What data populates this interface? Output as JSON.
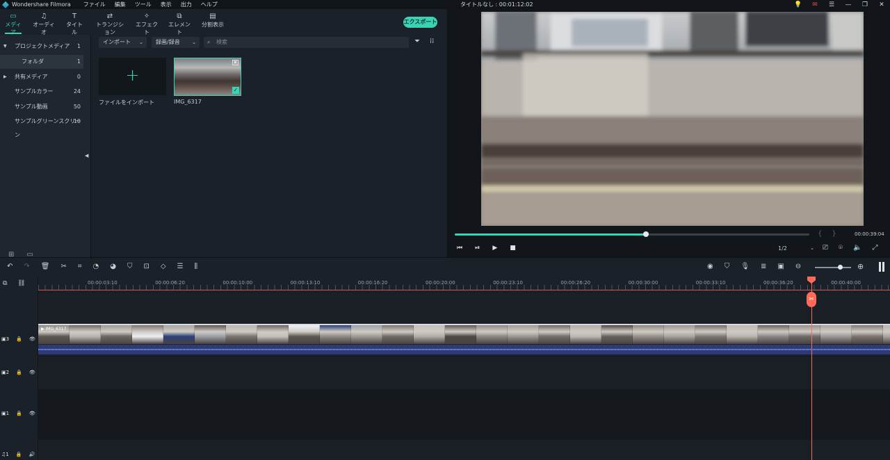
{
  "titlebar": {
    "app_name": "Wondershare Filmora",
    "menu": [
      "ファイル",
      "編集",
      "ツール",
      "表示",
      "出力",
      "ヘルプ"
    ],
    "window_title": "タイトルなし : 00:01:12:02",
    "buttons": [
      "bulb-icon",
      "mail-icon",
      "menu-icon",
      "minimize-icon",
      "maximize-icon",
      "close-icon"
    ]
  },
  "tabs": [
    {
      "label": "メディア",
      "icon": "folder-icon",
      "active": true
    },
    {
      "label": "オーディオ",
      "icon": "music-icon"
    },
    {
      "label": "タイトル",
      "icon": "title-icon"
    },
    {
      "label": "トランジション",
      "icon": "transition-icon"
    },
    {
      "label": "エフェクト",
      "icon": "effect-icon"
    },
    {
      "label": "エレメント",
      "icon": "element-icon"
    },
    {
      "label": "分割表示",
      "icon": "split-screen-icon"
    }
  ],
  "export_label": "エクスポート",
  "sidebar": {
    "items": [
      {
        "label": "プロジェクトメディア",
        "count": "1",
        "expandable": true
      },
      {
        "label": "フォルダ",
        "count": "1",
        "selected": true
      },
      {
        "label": "共有メディア",
        "count": "0",
        "expandable": true
      },
      {
        "label": "サンプルカラー",
        "count": "24"
      },
      {
        "label": "サンプル動画",
        "count": "50"
      },
      {
        "label": "サンプルグリーンスクリーン",
        "count": "10"
      }
    ]
  },
  "media": {
    "import_dropdown": "インポート",
    "record_dropdown": "録画/録音",
    "search_placeholder": "検索",
    "import_tile_label": "ファイルをインポート",
    "clip_label": "IMG_6317"
  },
  "preview": {
    "progress": 0.54,
    "time": "00:00:39:04",
    "quality": "1/2"
  },
  "timeline": {
    "ruler_labels": [
      "00:00:03:10",
      "00:00:06:20",
      "00:00:10:00",
      "00:00:13:10",
      "00:00:16:20",
      "00:00:20:00",
      "00:00:23:10",
      "00:00:26:20",
      "00:00:30:00",
      "00:00:33:10",
      "00:00:36:20",
      "00:00:40:00"
    ],
    "clip_name": "IMG_6317",
    "tracks": [
      "3",
      "2",
      "1",
      "1"
    ],
    "zoom": 0.7
  },
  "colors": {
    "accent": "#3ad4b5",
    "playhead": "#ff6a5a"
  }
}
